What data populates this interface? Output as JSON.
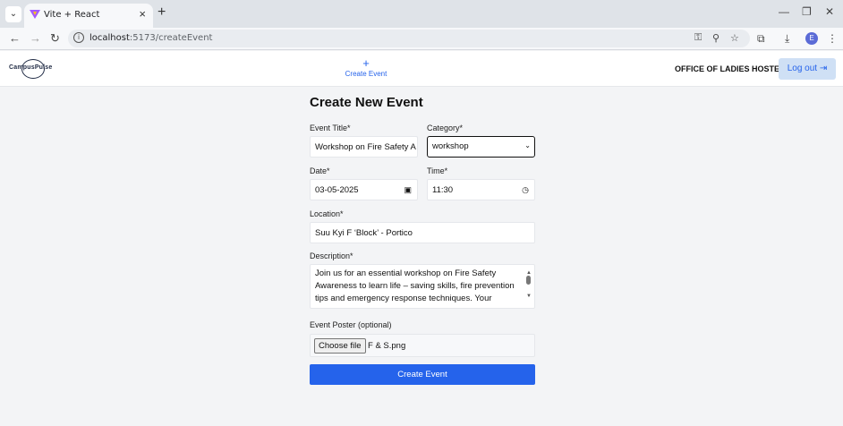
{
  "browser": {
    "tab_title": "Vite + React",
    "url_host": "localhost",
    "url_path": ":5173/createEvent"
  },
  "header": {
    "logo_text": "CampusPulse",
    "nav_create_label": "Create Event",
    "office_name": "OFFICE OF LADIES HOSTEL",
    "logout_label": "Log out"
  },
  "form": {
    "title": "Create New Event",
    "event_title_label": "Event Title*",
    "event_title_value": "Workshop on Fire Safety A",
    "category_label": "Category*",
    "category_value": "workshop",
    "date_label": "Date*",
    "date_value": "03-05-2025",
    "time_label": "Time*",
    "time_value": "11:30",
    "location_label": "Location*",
    "location_value": "Suu Kyi F ‘Block’ - Portico",
    "description_label": "Description*",
    "description_value": "Join us for an essential workshop on Fire Safety Awareness to learn life – saving skills, fire prevention tips and emergency response techniques. Your",
    "poster_label": "Event Poster (optional)",
    "choose_file_label": "Choose file",
    "file_name": "F & S.png",
    "submit_label": "Create Event"
  },
  "colors": {
    "accent": "#2563eb",
    "logout_bg": "#cfe0f5",
    "page_bg": "#f3f4f6"
  }
}
